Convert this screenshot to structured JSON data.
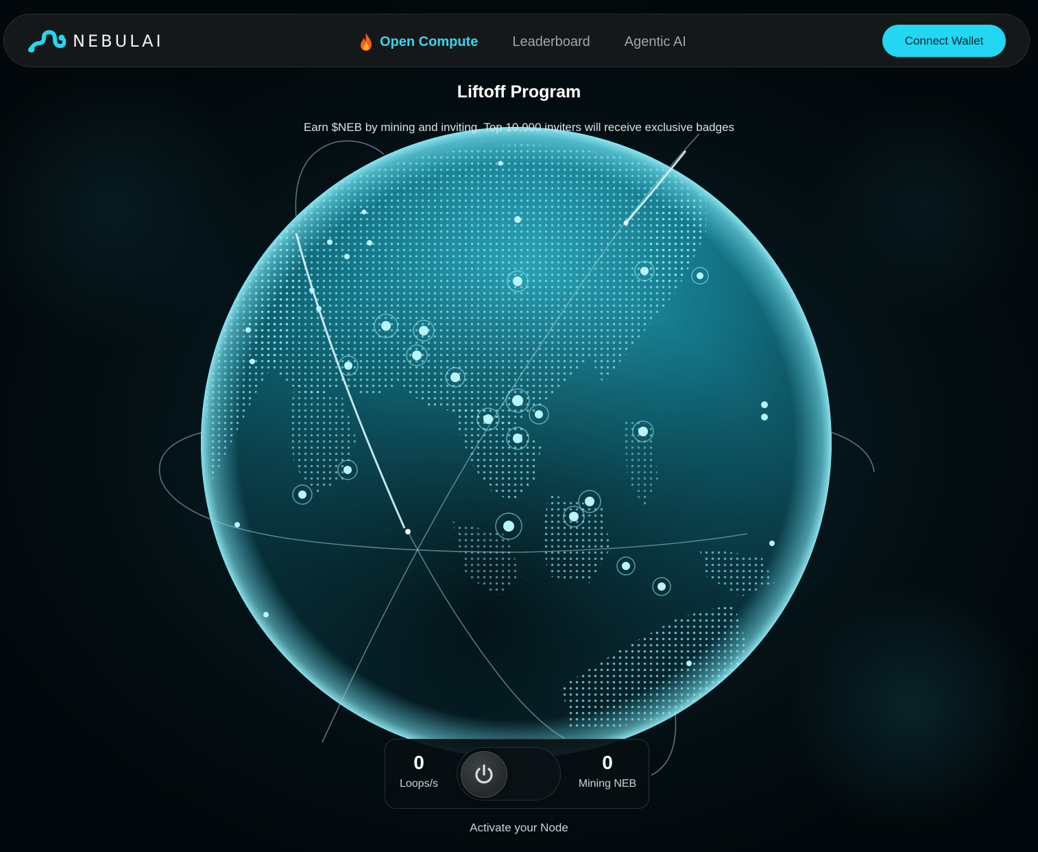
{
  "header": {
    "brand_name": "NEBULAI",
    "logo_icon": "nebulai-logo-icon",
    "nav": [
      {
        "label": "Open Compute",
        "icon": "fire-icon",
        "active": true
      },
      {
        "label": "Leaderboard",
        "active": false
      },
      {
        "label": "Agentic AI",
        "active": false
      }
    ],
    "connect_label": "Connect Wallet"
  },
  "hero": {
    "title": "Liftoff Program",
    "subtitle": "Earn $NEB by mining and inviting. Top 10,000 inviters will receive exclusive badges"
  },
  "node_panel": {
    "loops_value": "0",
    "loops_label": "Loops/s",
    "mining_value": "0",
    "mining_label": "Mining NEB",
    "power_icon": "power-icon",
    "activate_text": "Activate your Node"
  },
  "colors": {
    "accent": "#23d6f2",
    "active_nav": "#3ad3ee",
    "globe": "#1a6f80",
    "background": "#02080b"
  }
}
